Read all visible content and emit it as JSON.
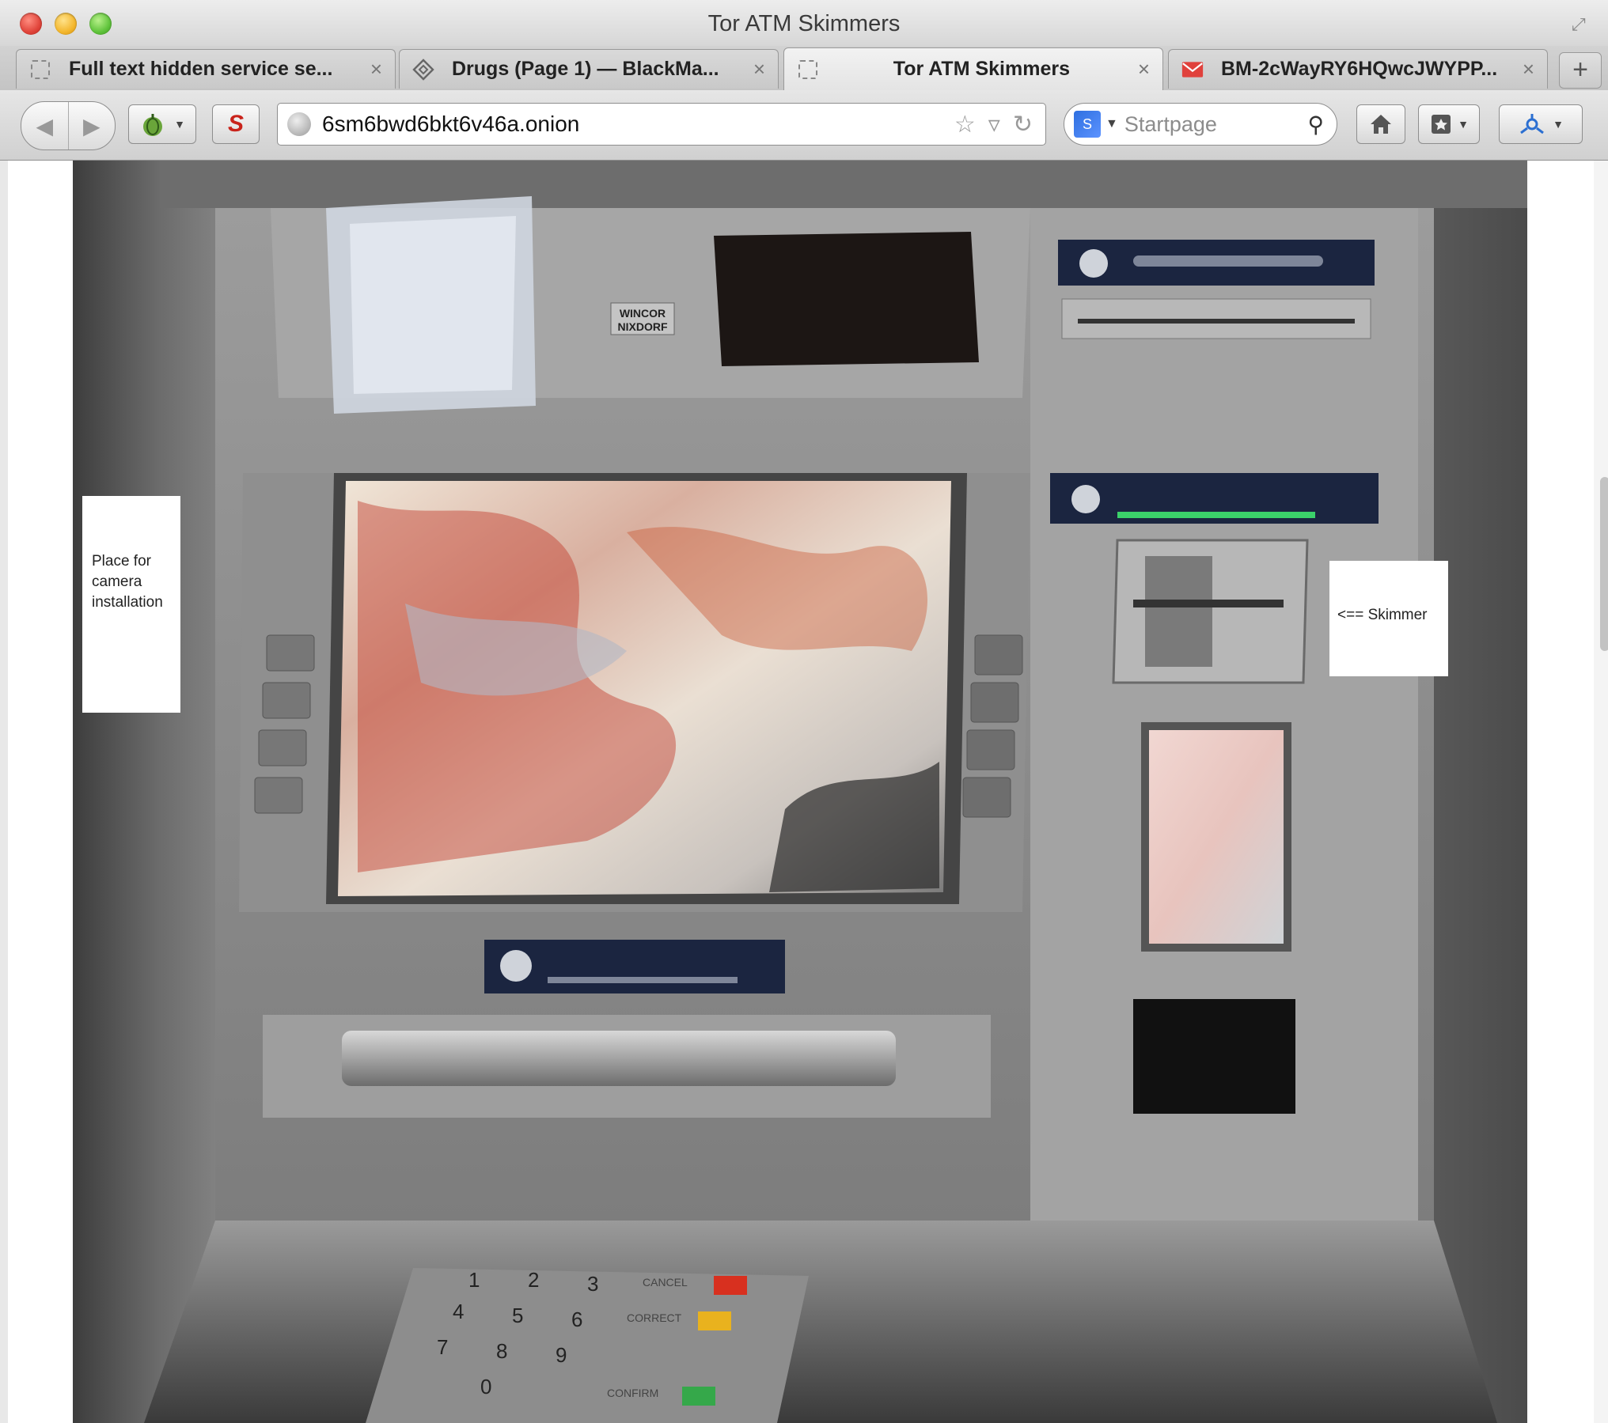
{
  "window": {
    "title": "Tor ATM Skimmers"
  },
  "tabs": [
    {
      "label": "Full text hidden service se...",
      "icon": "blank-page-icon",
      "active": false
    },
    {
      "label": "Drugs (Page 1) — BlackMa...",
      "icon": "site-favicon-icon",
      "active": false
    },
    {
      "label": "Tor ATM Skimmers",
      "icon": "blank-page-icon",
      "active": true
    },
    {
      "label": "BM-2cWayRY6HQwcJWYPP...",
      "icon": "mail-icon",
      "active": false
    }
  ],
  "toolbar": {
    "url": "6sm6bwd6bkt6v46a.onion",
    "search_placeholder": "Startpage"
  },
  "page": {
    "note_camera": "Place for camera installation",
    "note_skimmer": "<== Skimmer",
    "atm_brand": "WINCOR NIXDORF",
    "keypad": {
      "digits": [
        "1",
        "2",
        "3",
        "4",
        "5",
        "6",
        "7",
        "8",
        "9",
        "0"
      ],
      "cancel": "CANCEL",
      "correct": "CORRECT",
      "confirm": "CONFIRM"
    }
  },
  "colors": {
    "cancel_key": "#d8301f",
    "correct_key": "#e9b21e",
    "confirm_key": "#35a84a",
    "panel_navy": "#1b2540"
  }
}
